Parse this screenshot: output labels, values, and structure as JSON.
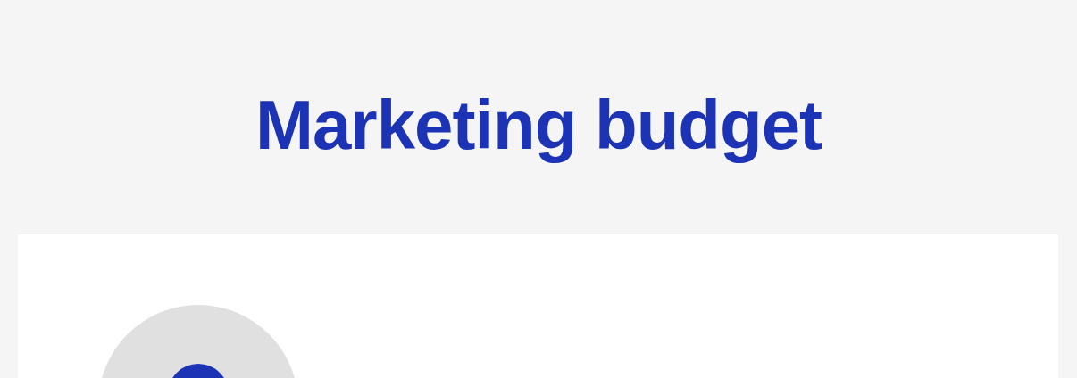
{
  "title": "Marketing budget"
}
